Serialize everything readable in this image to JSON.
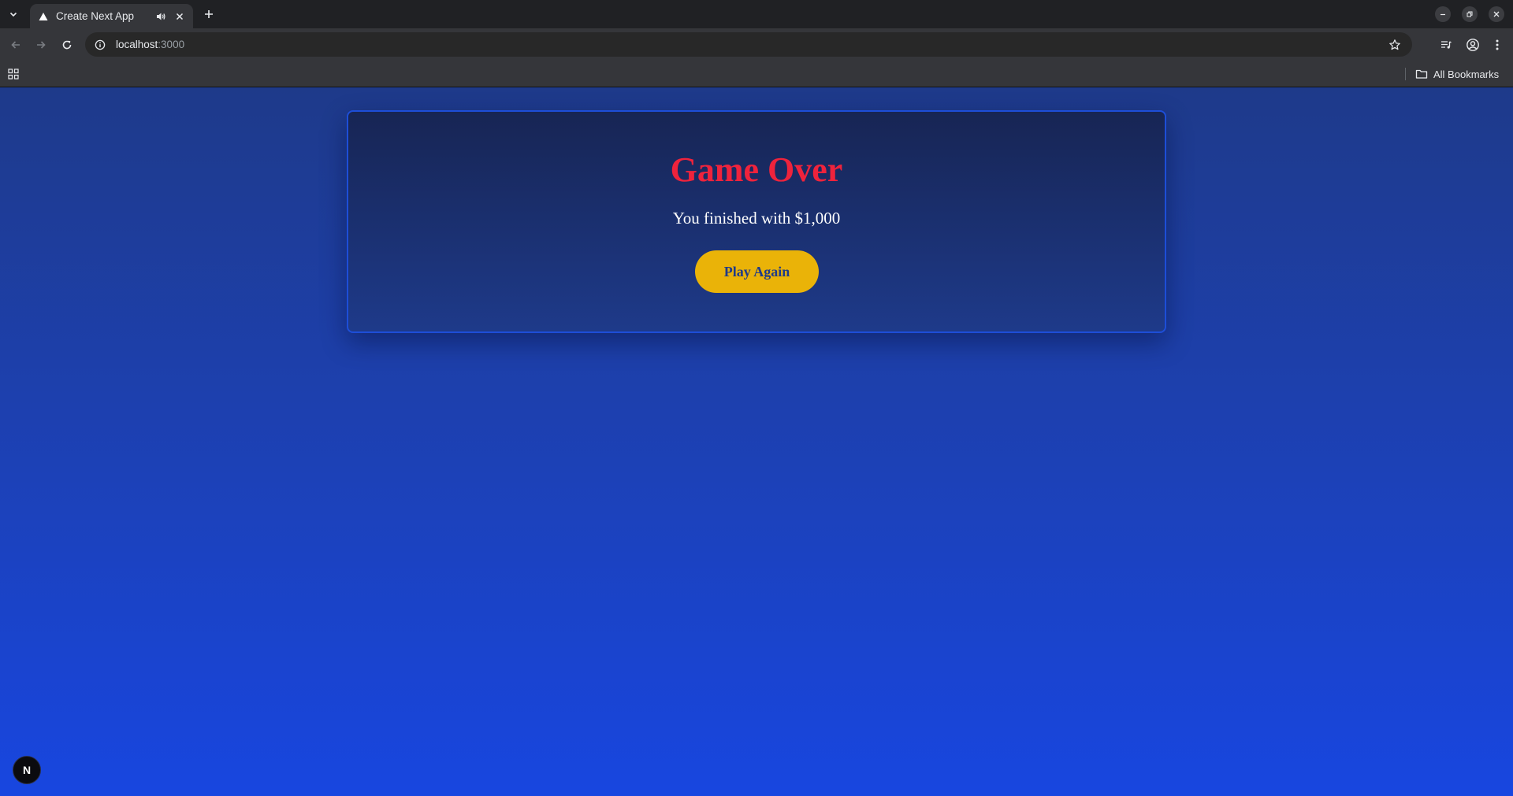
{
  "browser": {
    "tab_title": "Create Next App",
    "url_host": "localhost",
    "url_port": ":3000",
    "bookmarks_label": "All Bookmarks"
  },
  "icons": {
    "tab_list": "chevron-down-icon",
    "favicon": "nextjs-triangle-icon",
    "audio": "speaker-icon",
    "close": "close-icon",
    "new_tab": "plus-icon",
    "back": "arrow-left-icon",
    "forward": "arrow-right-icon",
    "reload": "reload-icon",
    "site_info": "info-icon",
    "bookmark": "star-icon",
    "media": "media-control-icon",
    "profile": "profile-icon",
    "menu": "kebab-menu-icon",
    "apps": "apps-grid-icon",
    "folder": "folder-icon",
    "next_badge": "nextjs-logo-icon"
  },
  "game_over": {
    "title": "Game Over",
    "message": "You finished with $1,000",
    "play_again_label": "Play Again"
  },
  "next_badge": {
    "label": "N"
  },
  "colors": {
    "background_top": "#1e3a8a",
    "background_bottom": "#1846e0",
    "card_top": "#172554",
    "card_border": "#1d4ed8",
    "title": "#ef233c",
    "button": "#eab308",
    "button_text": "#1e3a8a"
  }
}
